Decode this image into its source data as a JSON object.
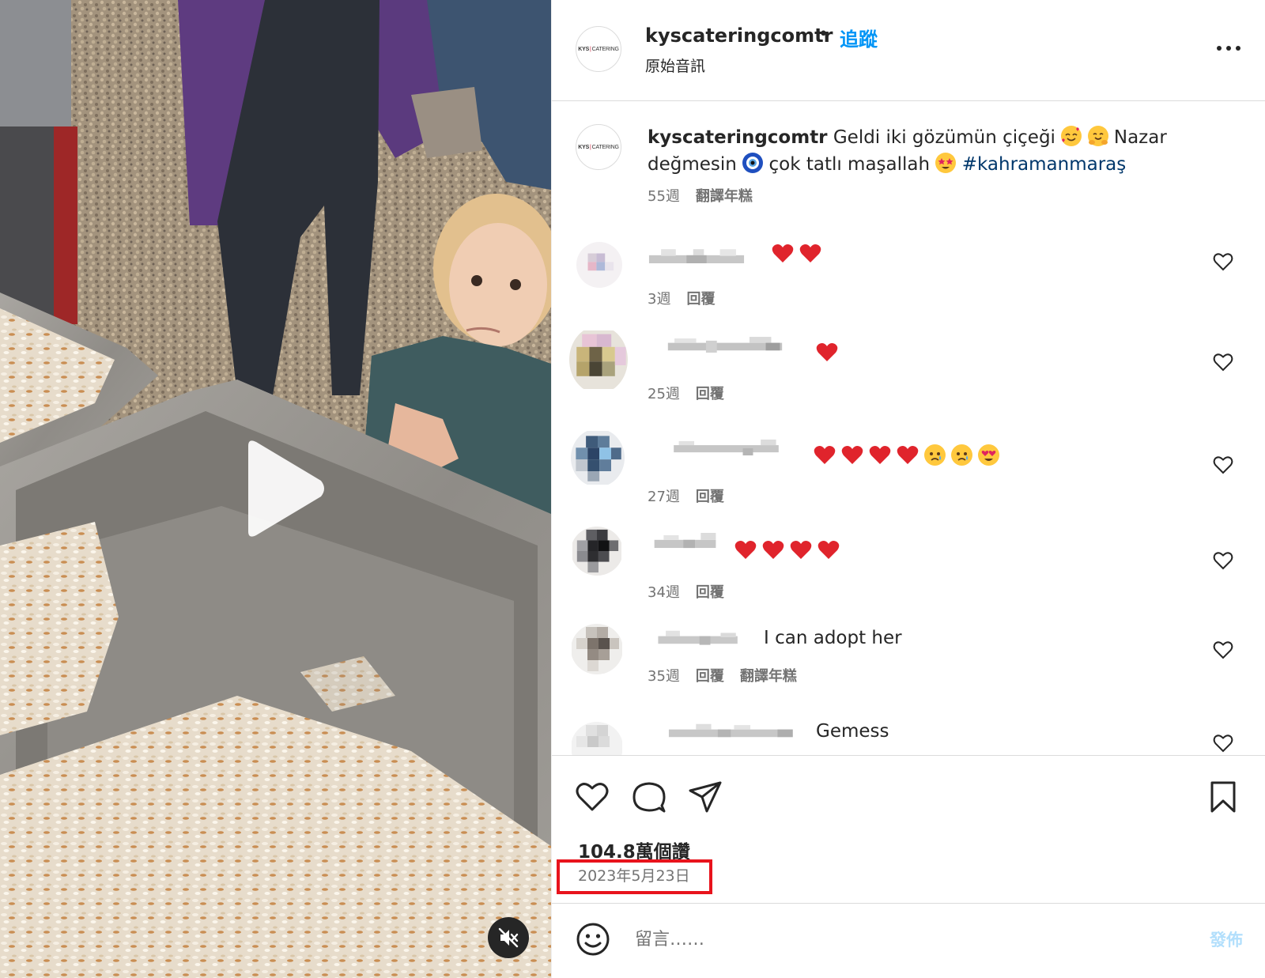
{
  "post": {
    "username": "kyscateringcomtr",
    "separator": "•",
    "follow_label": "追蹤",
    "audio_label": "原始音訊",
    "logo_text_bold": "KYS",
    "logo_text_rest": "CATERING",
    "caption_text_1": " Geldi iki gözümün çiçeği ",
    "caption_text_2": " Nazar değmesin ",
    "caption_text_3": " çok tatlı maşallah ",
    "hashtag": "#kahramanmaraş",
    "caption_age": "55週",
    "translate_label": "翻譯年糕"
  },
  "comments": [
    {
      "text": "",
      "age": "3週",
      "reply_label": "回覆",
      "hearts": 2,
      "faces": 0
    },
    {
      "text": "",
      "age": "25週",
      "reply_label": "回覆",
      "hearts": 1,
      "faces": 0
    },
    {
      "text": "",
      "age": "27週",
      "reply_label": "回覆",
      "hearts": 4,
      "faces": 3
    },
    {
      "text": "",
      "age": "34週",
      "reply_label": "回覆",
      "hearts": 4,
      "faces": 0
    },
    {
      "text": "I can adopt her",
      "age": "35週",
      "reply_label": "回覆",
      "translate_label": "翻譯年糕",
      "hearts": 0,
      "faces": 0
    },
    {
      "text": "Gemess",
      "hearts": 0,
      "faces": 0
    }
  ],
  "likes_label": "104.8萬個讚",
  "date_label": "2023年5月23日",
  "comment_box": {
    "placeholder": "留言……",
    "post_label": "發佈"
  },
  "icons": {
    "play": "play-icon",
    "mute": "muted-speaker-icon",
    "more": "more-options-icon",
    "like": "heart-icon",
    "comment": "comment-bubble-icon",
    "share": "send-paper-plane-icon",
    "save": "bookmark-icon",
    "emoji": "smiley-icon"
  },
  "colors": {
    "link": "#0095f6",
    "hashtag": "#00376b",
    "highlight": "#e8131c",
    "muted_text": "#737373",
    "post_disabled": "#b2dffc"
  }
}
